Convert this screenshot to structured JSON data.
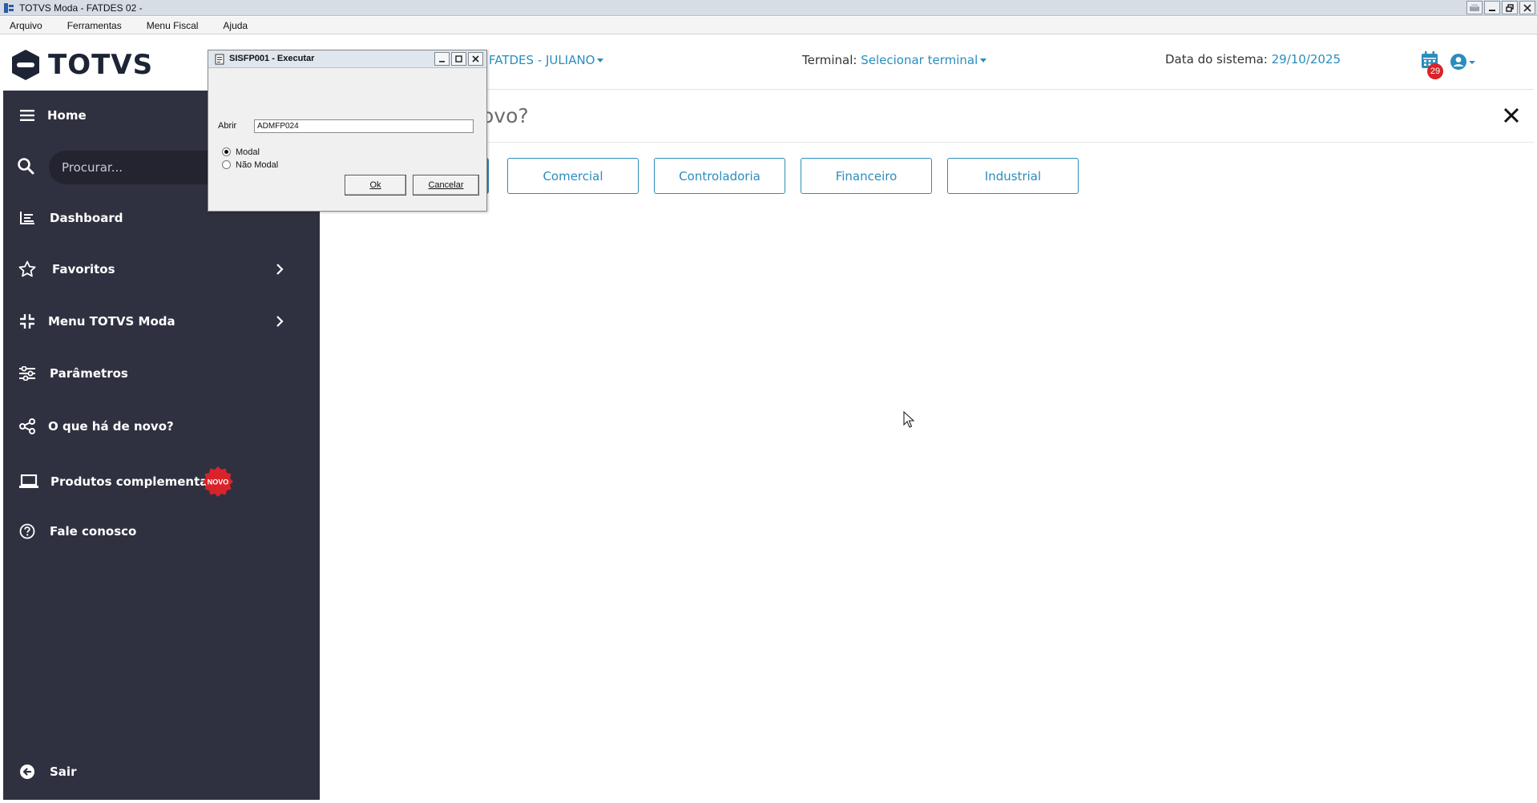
{
  "window": {
    "title": "TOTVS Moda - FATDES 02 -"
  },
  "menubar": {
    "items": [
      "Arquivo",
      "Ferramentas",
      "Menu Fiscal",
      "Ajuda"
    ]
  },
  "sidebar": {
    "logo_text": "TOTVS",
    "search_placeholder": "Procurar...",
    "items": [
      {
        "label": "Home",
        "icon": "hamburger-icon"
      },
      {
        "label": "Dashboard",
        "icon": "chart-icon"
      },
      {
        "label": "Favoritos",
        "icon": "star-icon",
        "has_submenu": true
      },
      {
        "label": "Menu TOTVS Moda",
        "icon": "compress-icon",
        "has_submenu": true
      },
      {
        "label": "Parâmetros",
        "icon": "sliders-icon"
      },
      {
        "label": "O que há de novo?",
        "icon": "share-icon"
      },
      {
        "label": "Produtos complementares",
        "icon": "laptop-icon",
        "badge": "NOVO"
      },
      {
        "label": "Fale conosco",
        "icon": "help-icon"
      },
      {
        "label": "Sair",
        "icon": "exit-icon"
      }
    ]
  },
  "header": {
    "company": "FATDES - JULIANO",
    "terminal_label": "Terminal:",
    "terminal_value": "Selecionar terminal",
    "date_label": "Data do sistema:",
    "date_value": "29/10/2025",
    "notification_count": "29"
  },
  "main": {
    "title_fragment": "ovo?",
    "categories": [
      "Comercial",
      "Controladoria",
      "Financeiro",
      "Industrial"
    ]
  },
  "dialog": {
    "title": "SISFP001 - Executar",
    "open_label": "Abrir",
    "open_value": "ADMFP024",
    "radio_modal": "Modal",
    "radio_non_modal": "Não Modal",
    "ok_label": "Ok",
    "cancel_label": "Cancelar"
  },
  "colors": {
    "sidebar_bg": "#2f3140",
    "accent": "#2a8dbd",
    "badge_red": "#d9232a"
  }
}
